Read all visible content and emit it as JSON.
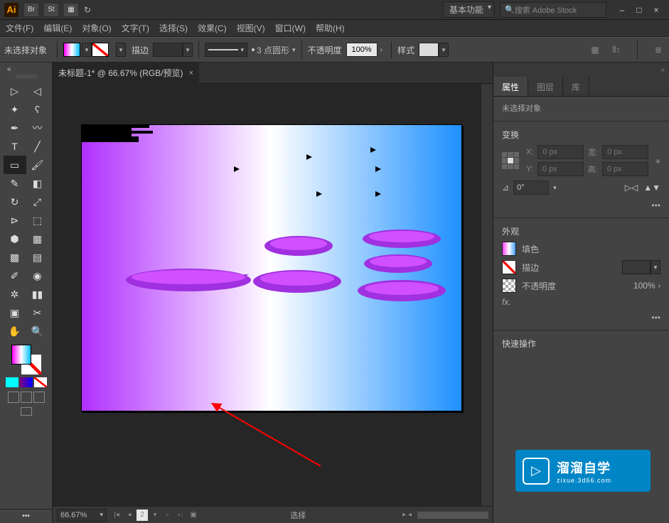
{
  "titlebar": {
    "app_short": "Ai",
    "bridge": "Br",
    "stock": "St",
    "workspace": "基本功能",
    "search_placeholder": "搜索 Adobe Stock"
  },
  "window_controls": {
    "min": "–",
    "max": "□",
    "close": "×"
  },
  "menus": {
    "file": "文件(F)",
    "edit": "编辑(E)",
    "object": "对象(O)",
    "type": "文字(T)",
    "select": "选择(S)",
    "effect": "效果(C)",
    "view": "视图(V)",
    "window": "窗口(W)",
    "help": "帮助(H)"
  },
  "controlbar": {
    "noselection": "未选择对象",
    "stroke_label": "描边",
    "stroke_wt": "",
    "dash_label": "3 点圆形",
    "opacity_label": "不透明度",
    "opacity": "100%",
    "style_label": "样式"
  },
  "doc": {
    "tab_title": "未标题-1* @ 66.67% (RGB/预览)",
    "zoom": "66.67%",
    "artboard_index": "2",
    "status_mode": "选择"
  },
  "panels": {
    "prop_tab": "属性",
    "layers_tab": "图层",
    "libs_tab": "库",
    "no_selection": "未选择对象",
    "transform_hdr": "变换",
    "x_lbl": "X:",
    "y_lbl": "Y:",
    "w_lbl": "宽:",
    "h_lbl": "高:",
    "x_val": "0 px",
    "y_val": "0 px",
    "w_val": "0 px",
    "h_val": "0 px",
    "angle": "0°",
    "appearance_hdr": "外观",
    "fill_lbl": "填色",
    "stroke_lbl": "描边",
    "opacity_lbl": "不透明度",
    "opacity_val": "100%",
    "fx": "fx.",
    "quick_hdr": "快速操作"
  },
  "watermark": {
    "name": "溜溜自学",
    "url": "zixue.3d66.com",
    "play": "▷"
  }
}
